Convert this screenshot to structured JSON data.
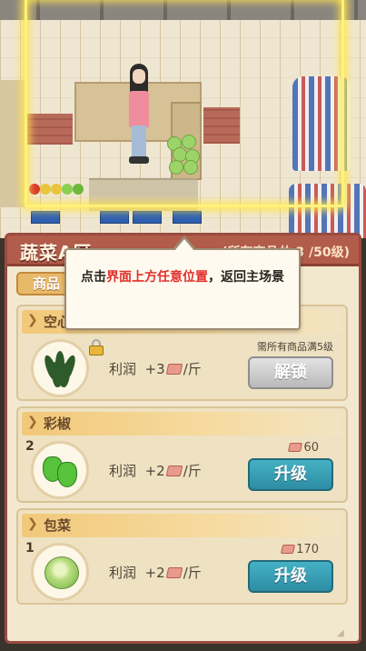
{
  "panel": {
    "title": "蔬菜A区",
    "progress": "(所有商品共 3 /50级)",
    "tab_label": "商品"
  },
  "tooltip": {
    "prefix": "点击",
    "highlight": "界面上方任意位置",
    "suffix": "，返回主场景"
  },
  "products": [
    {
      "name": "空心菜",
      "level": "",
      "profit_label": "利润",
      "profit_value": "+3",
      "profit_unit": "/斤",
      "locked": true,
      "requirement": "需所有商品满5级",
      "button_label": "解锁",
      "icon": "water-spinach-icon"
    },
    {
      "name": "彩椒",
      "level": "2",
      "profit_label": "利润",
      "profit_value": "+2",
      "profit_unit": "/斤",
      "locked": false,
      "cost": "60",
      "button_label": "升级",
      "icon": "bell-pepper-icon"
    },
    {
      "name": "包菜",
      "level": "1",
      "profit_label": "利润",
      "profit_value": "+2",
      "profit_unit": "/斤",
      "locked": false,
      "cost": "170",
      "button_label": "升级",
      "icon": "cabbage-icon"
    }
  ],
  "colors": {
    "highlight_frame": "#fff27a",
    "header": "#b25c4c",
    "upgrade_button": "#2d8da3",
    "tooltip_highlight": "#e0302a"
  }
}
